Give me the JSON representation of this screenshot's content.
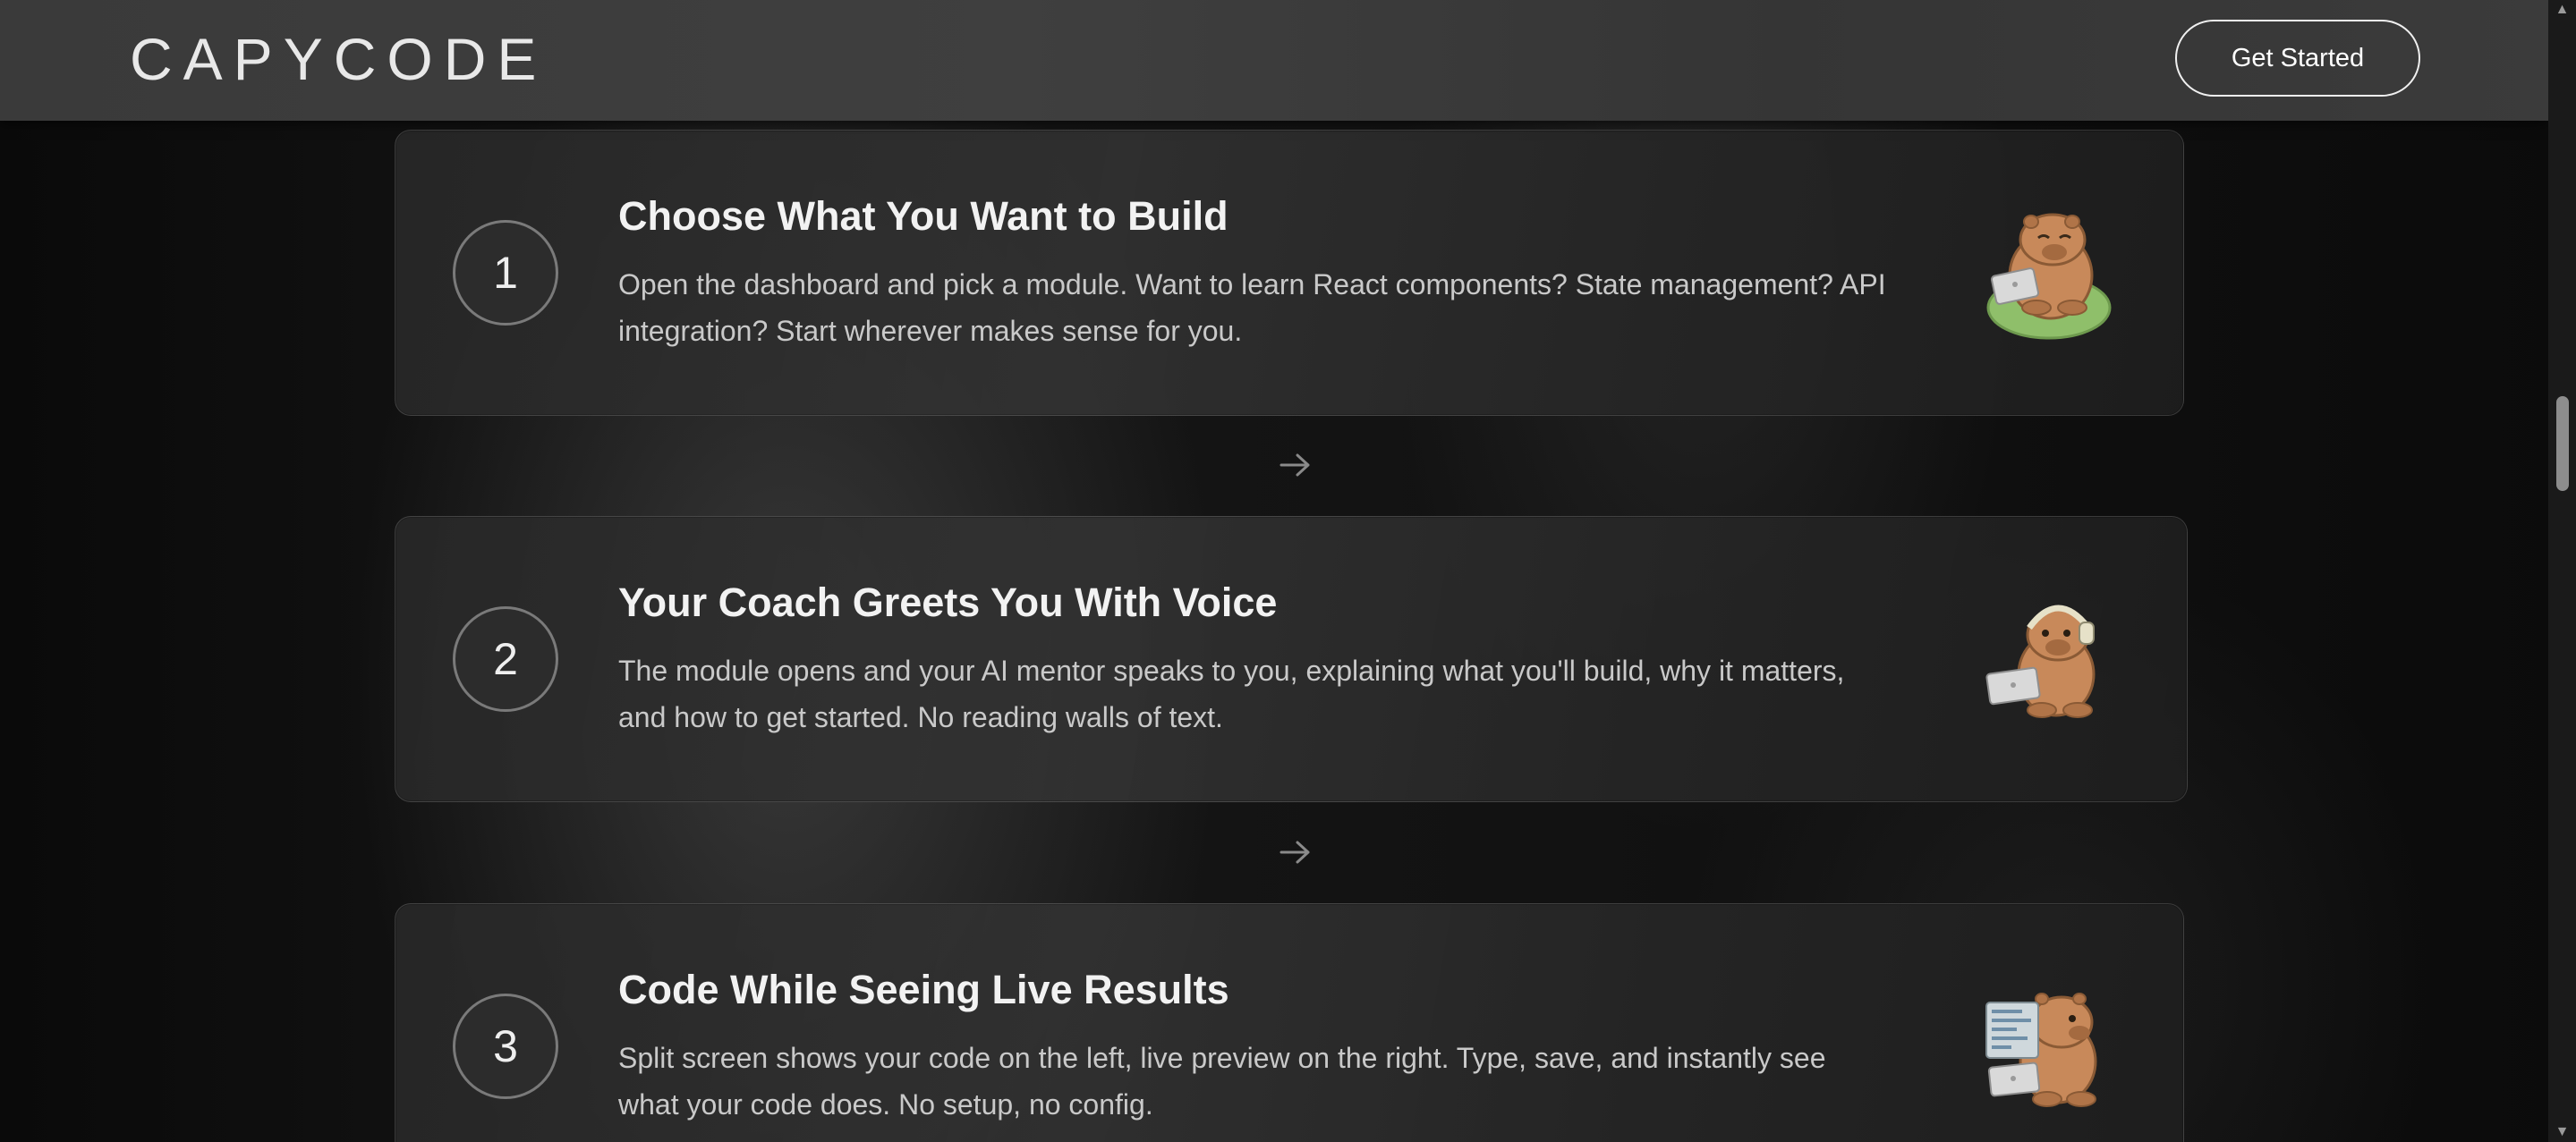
{
  "header": {
    "logo": "CAPYCODE",
    "cta_label": "Get Started"
  },
  "steps": [
    {
      "number": "1",
      "title": "Choose What You Want to Build",
      "description": "Open the dashboard and pick a module. Want to learn React components? State management? API integration? Start wherever makes sense for you.",
      "mascot": "capybara-on-beanbag-with-laptop-icon"
    },
    {
      "number": "2",
      "title": "Your Coach Greets You With Voice",
      "description": "The module opens and your AI mentor speaks to you, explaining what you'll build, why it matters, and how to get started. No reading walls of text.",
      "mascot": "capybara-with-headphones-and-laptop-icon"
    },
    {
      "number": "3",
      "title": "Code While Seeing Live Results",
      "description": "Split screen shows your code on the left, live preview on the right. Type, save, and instantly see what your code does. No setup, no config.",
      "mascot": "capybara-with-code-screen-icon"
    }
  ],
  "connector_icon": "arrow-right-icon",
  "colors": {
    "background": "#0c0c0c",
    "header": "#3c3c3c",
    "text_primary": "#f2f2f2",
    "text_secondary": "#c9c9c9",
    "accent_capybara": "#c8895a"
  }
}
